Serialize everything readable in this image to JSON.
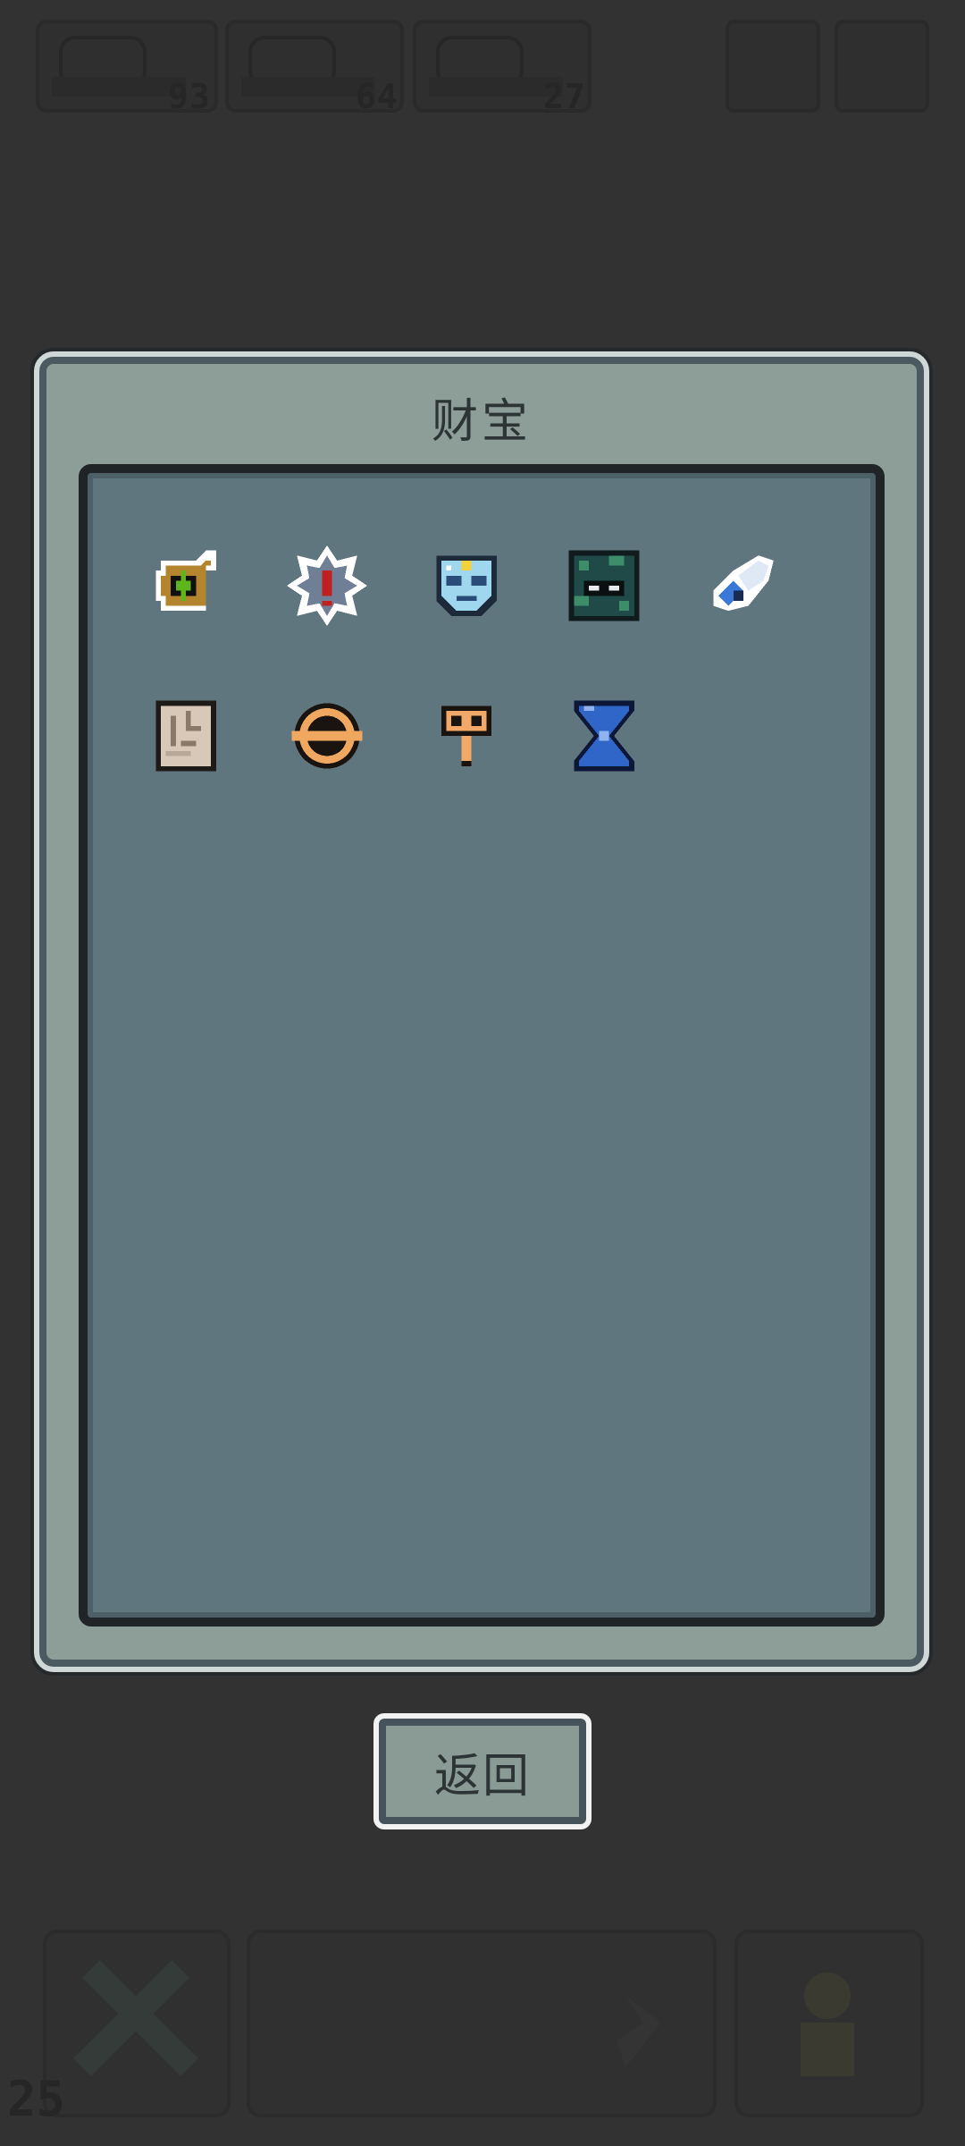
{
  "hud": {
    "resource_1": "93",
    "resource_2": "64",
    "resource_3": "27",
    "level": "25"
  },
  "dialog": {
    "title": "财宝",
    "back_label": "返回"
  },
  "treasures": [
    {
      "icon": "green-cross-scroll-icon"
    },
    {
      "icon": "spiked-gem-icon"
    },
    {
      "icon": "crystal-mask-icon"
    },
    {
      "icon": "dark-mossy-block-icon"
    },
    {
      "icon": "winged-orb-icon"
    },
    {
      "icon": "ancient-stone-tablet-icon"
    },
    {
      "icon": "bronze-ring-icon"
    },
    {
      "icon": "copper-key-icon"
    },
    {
      "icon": "blue-hourglass-icon"
    }
  ]
}
